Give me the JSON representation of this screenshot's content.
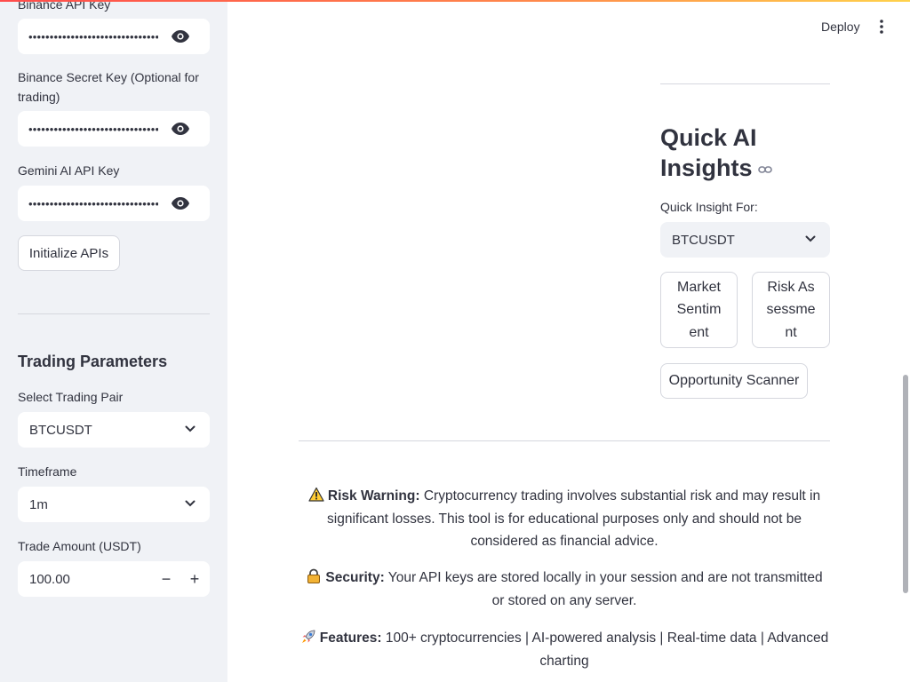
{
  "sidebar": {
    "binance_api_key": {
      "label": "Binance API Key",
      "value": "••••••••••••••••••••••••••••••••••••"
    },
    "binance_secret_key": {
      "label": "Binance Secret Key (Optional for trading)",
      "value": "••••••••••••••••••••••••••••••••••••"
    },
    "gemini_api_key": {
      "label": "Gemini AI API Key",
      "value": "••••••••••••••••••••••••••••••••••••"
    },
    "initialize_button": "Initialize APIs",
    "trading_parameters": {
      "heading": "Trading Parameters",
      "pair_label": "Select Trading Pair",
      "pair_value": "BTCUSDT",
      "timeframe_label": "Timeframe",
      "timeframe_value": "1m",
      "amount_label": "Trade Amount (USDT)",
      "amount_value": "100.00",
      "minus": "−",
      "plus": "+"
    }
  },
  "header": {
    "deploy": "Deploy"
  },
  "quick_ai": {
    "title": "Quick AI Insights",
    "select_label": "Quick Insight For:",
    "select_value": "BTCUSDT",
    "market_sentiment": "Market Sentiment",
    "risk_assessment": "Risk Assessment",
    "opportunity_scanner": "Opportunity Scanner"
  },
  "footer": {
    "risk_bold": "Risk Warning:",
    "risk_text": "Cryptocurrency trading involves substantial risk and may result in significant losses. This tool is for educational purposes only and should not be considered as financial advice.",
    "security_bold": "Security:",
    "security_text": "Your API keys are stored locally in your session and are not transmitted or stored on any server.",
    "features_bold": "Features:",
    "features_text": "100+ cryptocurrencies | AI-powered analysis | Real-time data | Advanced charting"
  },
  "icons": {
    "eye": "eye-icon",
    "chevron": "chevron-down-icon",
    "link": "link-icon",
    "warning": "warning-icon",
    "lock": "lock-icon",
    "rocket": "rocket-icon",
    "kebab": "more-vertical-icon"
  },
  "colors": {
    "accent": "#ff4b4b",
    "sidebar_bg": "#f0f2f6"
  }
}
